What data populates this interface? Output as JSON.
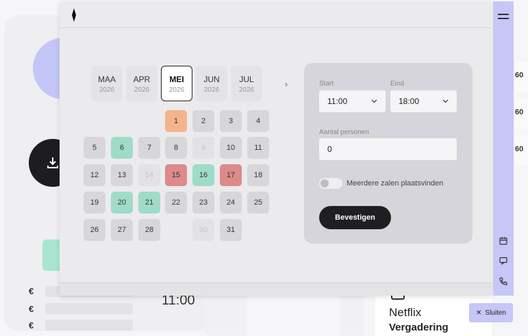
{
  "months": [
    {
      "name": "MAA",
      "year": "2026"
    },
    {
      "name": "APR",
      "year": "2026"
    },
    {
      "name": "MEI",
      "year": "2026"
    },
    {
      "name": "JUN",
      "year": "2026"
    },
    {
      "name": "JUL",
      "year": "2026"
    }
  ],
  "days": [
    {
      "d": "1",
      "state": "orange"
    },
    {
      "d": "2",
      "state": "normal"
    },
    {
      "d": "3",
      "state": "normal"
    },
    {
      "d": "4",
      "state": "normal"
    },
    {
      "d": "5",
      "state": "normal"
    },
    {
      "d": "6",
      "state": "green"
    },
    {
      "d": "7",
      "state": "normal"
    },
    {
      "d": "8",
      "state": "normal"
    },
    {
      "d": "9",
      "state": "disabled"
    },
    {
      "d": "10",
      "state": "normal"
    },
    {
      "d": "11",
      "state": "normal"
    },
    {
      "d": "12",
      "state": "normal"
    },
    {
      "d": "13",
      "state": "normal"
    },
    {
      "d": "14",
      "state": "disabled"
    },
    {
      "d": "15",
      "state": "red"
    },
    {
      "d": "16",
      "state": "green"
    },
    {
      "d": "17",
      "state": "red"
    },
    {
      "d": "18",
      "state": "normal"
    },
    {
      "d": "19",
      "state": "normal"
    },
    {
      "d": "20",
      "state": "green"
    },
    {
      "d": "21",
      "state": "green"
    },
    {
      "d": "22",
      "state": "normal"
    },
    {
      "d": "23",
      "state": "normal"
    },
    {
      "d": "24",
      "state": "normal"
    },
    {
      "d": "25",
      "state": "normal"
    },
    {
      "d": "26",
      "state": "normal"
    },
    {
      "d": "27",
      "state": "normal"
    },
    {
      "d": "28",
      "state": "normal"
    },
    {
      "d": "30",
      "state": "disabled"
    },
    {
      "d": "31",
      "state": "normal"
    }
  ],
  "form": {
    "start_label": "Start",
    "start_value": "11:00",
    "end_label": "Eind",
    "end_value": "18:00",
    "persons_label": "Aantal personen",
    "persons_value": "0",
    "toggle_label": "Meerdere zalen plaatsvinden",
    "confirm_label": "Bevestigen"
  },
  "background": {
    "currency": "€",
    "time": "11:00",
    "right_text": "60",
    "card_title": "Netflix",
    "card_subtitle": "Vergadering",
    "close_label": "Sluiten"
  },
  "colors": {
    "sidebar": "#c5c7f6",
    "green": "#9fdcc8",
    "red": "#dc8a8a",
    "orange": "#f4b48c",
    "dark": "#1f1f21"
  }
}
